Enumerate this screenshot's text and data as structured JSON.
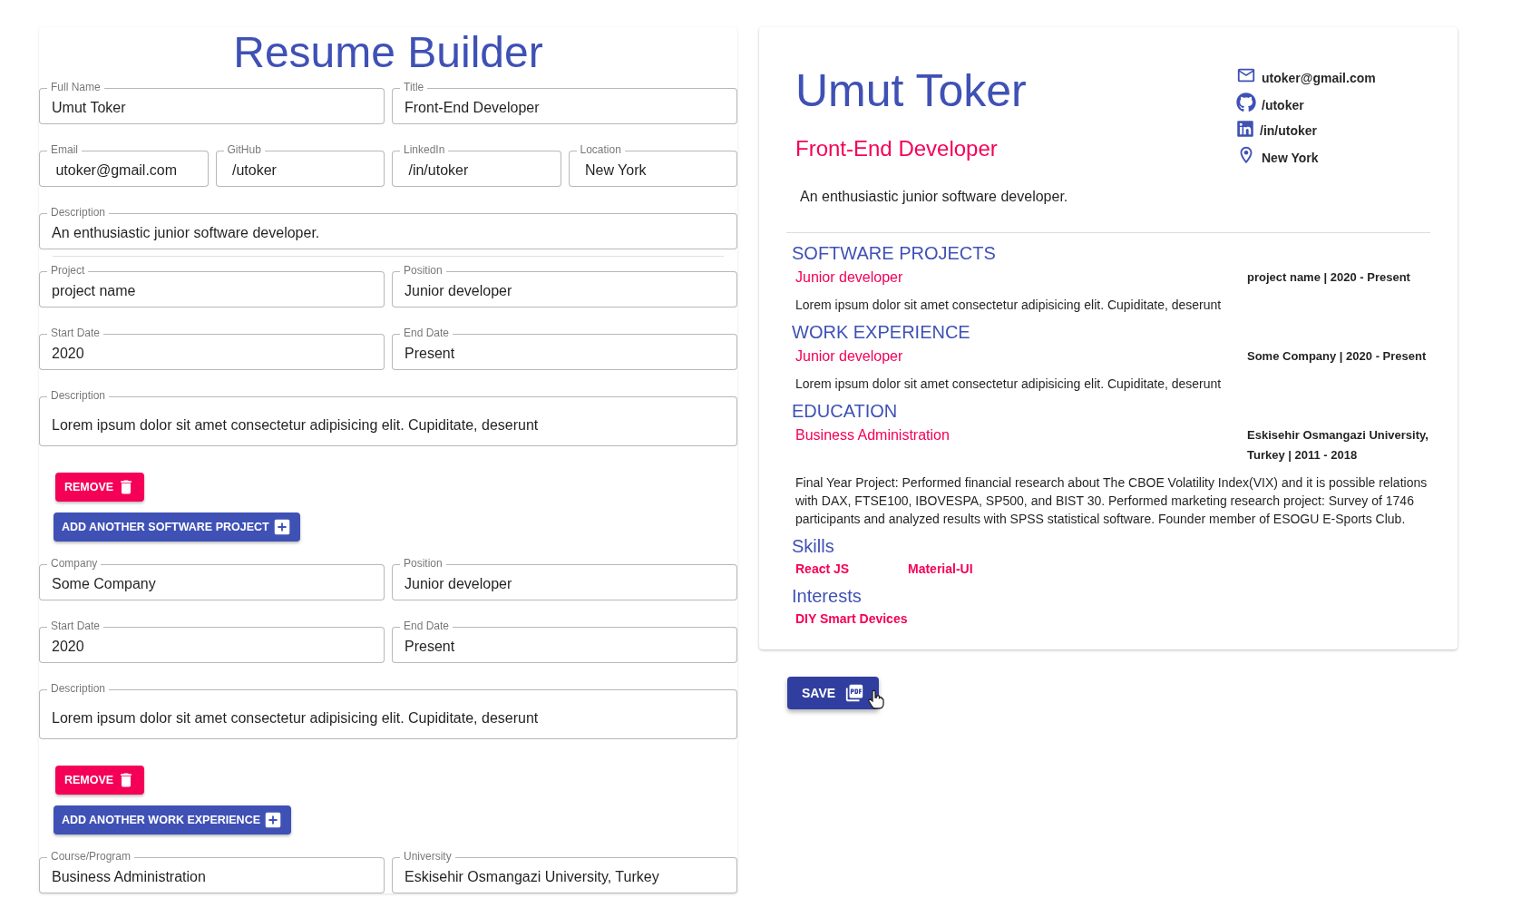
{
  "app_title": "Resume Builder",
  "form": {
    "personal": [
      [
        {
          "label": "Full Name",
          "value": "Umut Toker",
          "kind": "text"
        },
        {
          "label": "Title",
          "value": "Front-End Developer",
          "kind": "text"
        }
      ],
      [
        {
          "label": "Email",
          "value": " utoker@gmail.com",
          "kind": "text"
        },
        {
          "label": "GitHub",
          "value": " /utoker",
          "kind": "text"
        },
        {
          "label": "LinkedIn",
          "value": " /in/utoker",
          "kind": "text"
        },
        {
          "label": "Location",
          "value": " New York",
          "kind": "text"
        }
      ],
      [
        {
          "label": "Description",
          "value": "An enthusiastic junior software developer.",
          "kind": "text"
        }
      ]
    ],
    "groups": [
      {
        "rows": [
          [
            {
              "label": "Project",
              "value": "project name",
              "kind": "text"
            },
            {
              "label": "Position",
              "value": "Junior developer",
              "kind": "text"
            }
          ],
          [
            {
              "label": "Start Date",
              "value": "2020",
              "kind": "text"
            },
            {
              "label": "End Date",
              "value": "Present",
              "kind": "text"
            }
          ],
          [
            {
              "label": "Description",
              "value": "Lorem ipsum dolor sit amet consectetur adipisicing elit. Cupiditate, deserunt",
              "kind": "multiline"
            }
          ]
        ],
        "remove": "REMOVE",
        "add": "ADD ANOTHER SOFTWARE PROJECT"
      },
      {
        "rows": [
          [
            {
              "label": "Company",
              "value": "Some Company",
              "kind": "text"
            },
            {
              "label": "Position",
              "value": "Junior developer",
              "kind": "text"
            }
          ],
          [
            {
              "label": "Start Date",
              "value": "2020",
              "kind": "text"
            },
            {
              "label": "End Date",
              "value": "Present",
              "kind": "text"
            }
          ],
          [
            {
              "label": "Description",
              "value": "Lorem ipsum dolor sit amet consectetur adipisicing elit. Cupiditate, deserunt",
              "kind": "multiline"
            }
          ]
        ],
        "remove": "REMOVE",
        "add": "ADD ANOTHER WORK EXPERIENCE"
      },
      {
        "rows": [
          [
            {
              "label": "Course/Program",
              "value": "Business Administration",
              "kind": "text"
            },
            {
              "label": "University",
              "value": "Eskisehir Osmangazi University, Turkey",
              "kind": "text"
            }
          ]
        ]
      }
    ]
  },
  "preview": {
    "name": "Umut Toker",
    "title": "Front-End Developer",
    "contacts": [
      {
        "kind": "email",
        "text": "utoker@gmail.com"
      },
      {
        "kind": "github",
        "text": "/utoker"
      },
      {
        "kind": "linkedin",
        "text": "/in/utoker"
      },
      {
        "kind": "location",
        "text": "New York"
      }
    ],
    "summary": "An enthusiastic junior software developer.",
    "sections": [
      {
        "kind": "entries",
        "heading": "SOFTWARE PROJECTS",
        "entries": [
          {
            "role": "Junior developer",
            "meta": "project name | 2020 - Present",
            "description": "Lorem ipsum dolor sit amet consectetur adipisicing elit. Cupiditate, deserunt"
          }
        ]
      },
      {
        "kind": "entries",
        "heading": "WORK EXPERIENCE",
        "entries": [
          {
            "role": "Junior developer",
            "meta": "Some Company | 2020 - Present",
            "description": "Lorem ipsum dolor sit amet consectetur adipisicing elit. Cupiditate, deserunt"
          }
        ]
      },
      {
        "kind": "entries",
        "heading": "EDUCATION",
        "entries": [
          {
            "role": "Business Administration",
            "meta": "Eskisehir Osmangazi University, Turkey | 2011 - 2018",
            "description": "Final Year Project: Performed financial research about The CBOE Volatility Index(VIX) and it is possible relations with DAX, FTSE100, IBOVESPA, SP500, and BIST 30. Performed marketing research project: Survey of 1746 participants and analyzed results with SPSS statistical software. Founder member of ESOGU E-Sports Club."
          }
        ]
      },
      {
        "kind": "tags",
        "heading": "Skills",
        "items": [
          "React JS",
          "Material-UI"
        ]
      },
      {
        "kind": "tags",
        "heading": "Interests",
        "items": [
          "DIY Smart Devices"
        ]
      }
    ]
  },
  "save_button": "SAVE"
}
